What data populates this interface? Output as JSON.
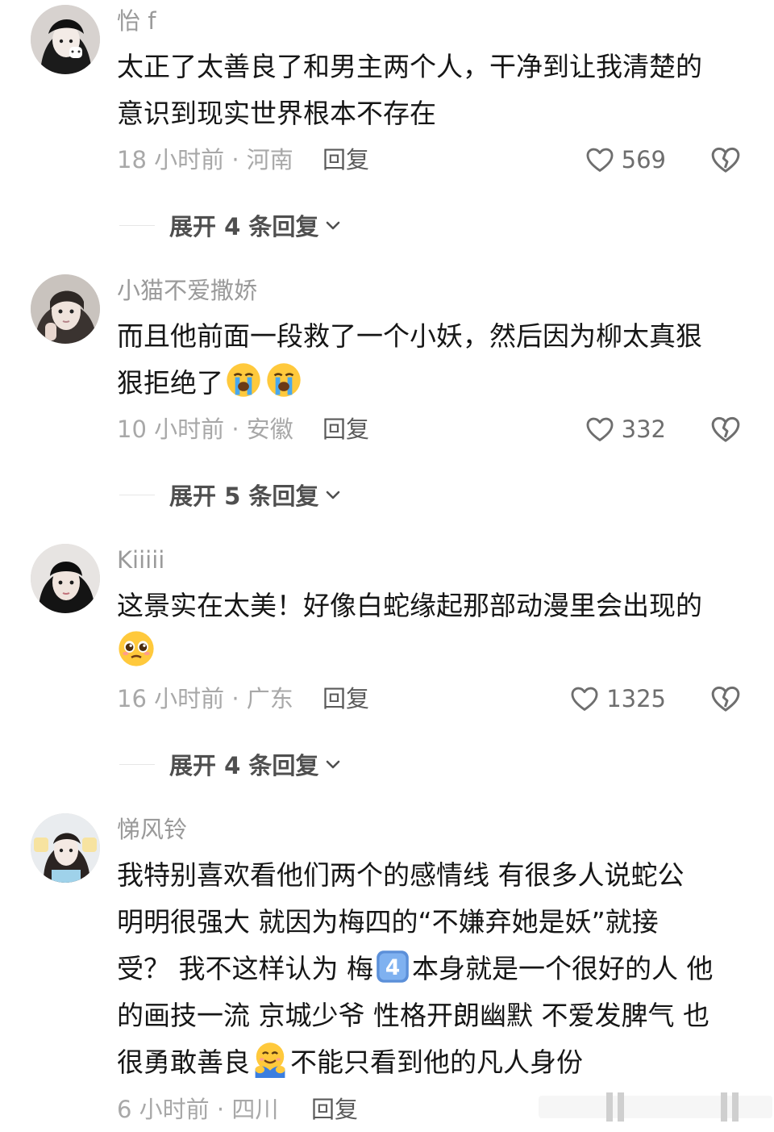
{
  "comments": [
    {
      "username": "怡 f",
      "lines": [
        "太正了太善良了和男主两个人，干净到让我清楚的",
        "意识到现实世界根本不存在"
      ],
      "time_location": "18 小时前 · 河南",
      "reply_label": "回复",
      "likes": "569",
      "expand_label": "展开 4 条回复"
    },
    {
      "username": "小猫不爱撒娇",
      "lines": [
        "而且他前面一段救了一个小妖，然后因为柳太真狠",
        "狠拒绝了"
      ],
      "emoji": [
        "loudly-crying-face",
        "loudly-crying-face"
      ],
      "time_location": "10 小时前 · 安徽",
      "reply_label": "回复",
      "likes": "332",
      "expand_label": "展开 5 条回复"
    },
    {
      "username": "Kiiiii",
      "lines": [
        "这景实在太美！好像白蛇缘起那部动漫里会出现的",
        ""
      ],
      "emoji": [
        "pleading-face"
      ],
      "time_location": "16 小时前 · 广东",
      "reply_label": "回复",
      "likes": "1325",
      "expand_label": "展开 4 条回复"
    },
    {
      "username": "悌风铃",
      "lines": [
        "我特别喜欢看他们两个的感情线 有很多人说蛇公",
        "明明很强大 就因为梅四的“不嫌弃她是妖”就接",
        "受？ 我不这样认为 梅",
        "本身就是一个很好的人 他",
        "的画技一流 京城少爷 性格开朗幽默 不爱发脾气 也",
        "很勇敢善良",
        "不能只看到他的凡人身份"
      ],
      "emoji": [
        "keycap-4",
        "hugging-face"
      ],
      "time_location": "6 小时前 · 四川",
      "reply_label": "回复"
    }
  ],
  "colors": {
    "username": "#9a9a9a",
    "body": "#161616",
    "meta": "#a8a8a8"
  }
}
